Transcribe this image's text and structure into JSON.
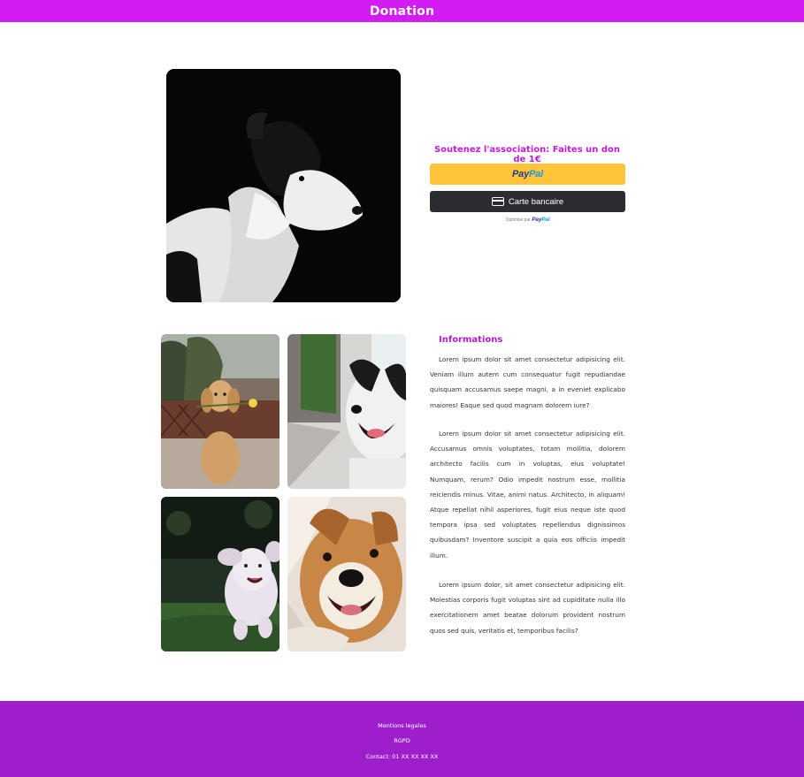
{
  "header": {
    "title": "Donation"
  },
  "donation": {
    "title": "Soutenez l'association: Faites un don de 1€",
    "paypal_button": {
      "part1": "Pay",
      "part2": "Pal"
    },
    "card_button_label": "Carte bancaire",
    "powered_by": {
      "prefix": "Optimisé par",
      "part1": "Pay",
      "part2": "Pal"
    }
  },
  "info": {
    "title": "Informations",
    "paragraphs": [
      "Lorem ipsum dolor sit amet consectetur adipisicing elit. Veniam illum autem cum consequatur fugit repudiandae quisquam accusamus saepe magni, a in eveniet explicabo maiores! Eaque sed quod magnam dolorem iure?",
      "Lorem ipsum dolor sit amet consectetur adipisicing elit. Accusamus omnis voluptates, totam mollitia, dolorem architecto facilis cum in voluptas, eius voluptate! Numquam, rerum? Odio impedit nostrum esse, mollitia reiciendis minus. Vitae, animi natus. Architecto, in aliquam! Atque repellat nihil asperiores, fugit eius neque iste quod tempora ipsa sed voluptates repellendus dignissimos quibusdam? Inventore suscipit a quia eos officiis impedit illum.",
      "Lorem ipsum dolor, sit amet consectetur adipisicing elit. Molestias corporis fugit voluptas sint ad cupiditate nulla illo exercitationem amet beatae dolorum provident nostrum quos sed quis, veritatis et, temporibus facilis?"
    ]
  },
  "footer": {
    "links": [
      "Mentions legales",
      "RGPD",
      "Contact: 01 XX XX XX XX"
    ]
  },
  "colors": {
    "header_bg": "#d21cf2",
    "accent_text": "#c21ad8",
    "paypal_yellow": "#ffc43a",
    "card_button_bg": "#2b2d31",
    "footer_bg": "#9d1fcc"
  }
}
